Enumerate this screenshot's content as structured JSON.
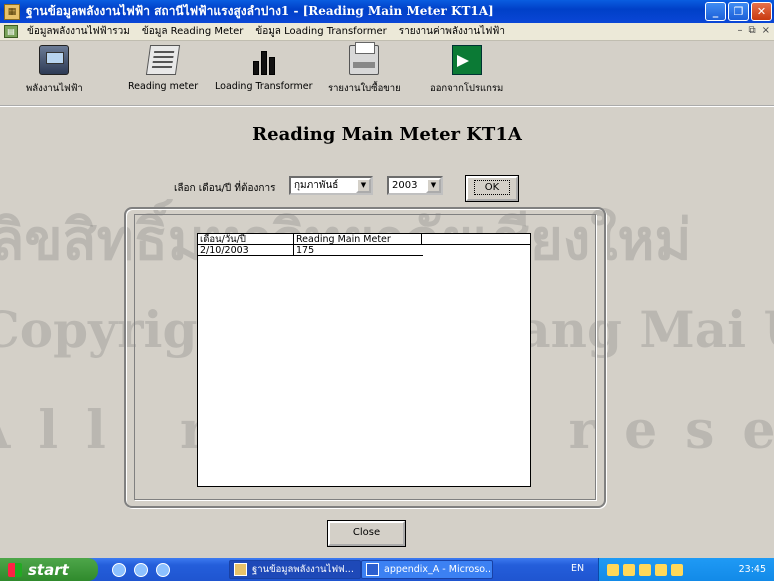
{
  "window": {
    "title": "ฐานข้อมูลพลังงานไฟฟ้า สถานีไฟฟ้าแรงสูงลำปาง1 - [Reading Main Meter KT1A]",
    "app_icon": "database-app-icon"
  },
  "menubar": {
    "items": [
      "ข้อมูลพลังงานไฟฟ้ารวม",
      "ข้อมูล Reading Meter",
      "ข้อมูล Loading Transformer",
      "รายงานค่าพลังงานไฟฟ้า"
    ],
    "mdi_controls": [
      "–",
      "⧉",
      "×"
    ]
  },
  "toolbar": {
    "buttons": [
      {
        "label": "พลังงานไฟฟ้า",
        "icon": "power-station-icon"
      },
      {
        "label": "Reading meter",
        "icon": "document-reading-icon"
      },
      {
        "label": "Loading Transformer",
        "icon": "bar-chart-icon"
      },
      {
        "label": "รายงานใบซื้อขาย",
        "icon": "printer-icon"
      },
      {
        "label": "ออกจากโปรแกรม",
        "icon": "exit-door-icon"
      }
    ]
  },
  "form": {
    "title": "Reading Main Meter KT1A",
    "select_label": "เลือก เดือน/ปี ที่ต้องการ",
    "month_value": "กุมภาพันธ์",
    "year_value": "2003",
    "ok_label": "OK",
    "close_label": "Close"
  },
  "grid": {
    "columns": [
      "เดือน/วัน/ปี",
      "Reading Main Meter"
    ],
    "rows": [
      [
        "2/10/2003",
        "175"
      ]
    ]
  },
  "watermark": {
    "line1": "ลิขสิทธิ์มหาวิทยาลัยเชียงใหม่",
    "line2": "Copyright © by Chiang Mai University",
    "line3": "All rights reserved"
  },
  "taskbar": {
    "start_label": "start",
    "tasks": [
      "ฐานข้อมูลพลังงานไฟฟ...",
      "appendix_A - Microso..."
    ],
    "language": "EN",
    "clock": "23:45"
  }
}
